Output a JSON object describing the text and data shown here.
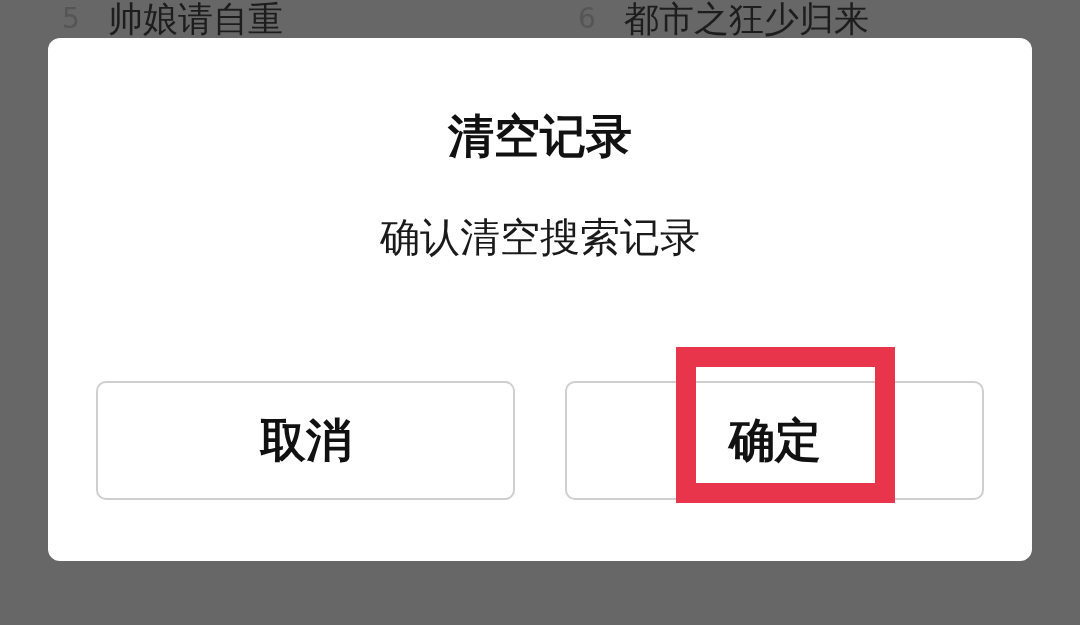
{
  "background_list": [
    {
      "number": "5",
      "title": "帅娘请自重"
    },
    {
      "number": "6",
      "title": "都市之狂少归来"
    }
  ],
  "dialog": {
    "title": "清空记录",
    "message": "确认清空搜索记录",
    "buttons": [
      {
        "label": "取消",
        "highlighted": false
      },
      {
        "label": "确定",
        "highlighted": true
      }
    ]
  }
}
